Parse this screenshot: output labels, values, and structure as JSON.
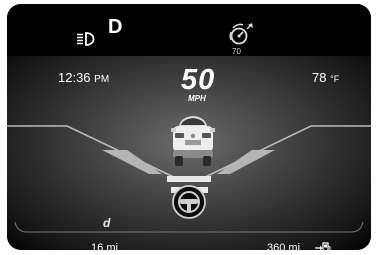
{
  "top": {
    "gear": "D",
    "cruise_set_speed": "70",
    "icons": [
      "headlight-icon",
      "cruise-control-icon"
    ]
  },
  "status": {
    "time_value": "12:36",
    "time_suffix": "PM",
    "temperature": "78",
    "temperature_unit": "°F"
  },
  "speed": {
    "value": "50",
    "unit": "MPH"
  },
  "drive": {
    "mode_letter": "d",
    "icons": [
      "lead-vehicle-icon",
      "steering-wheel-icon",
      "fuel-pump-icon"
    ]
  },
  "bottom": {
    "trip_value": "16",
    "trip_unit": "mi",
    "range_value": "360",
    "range_unit": "mi"
  }
}
